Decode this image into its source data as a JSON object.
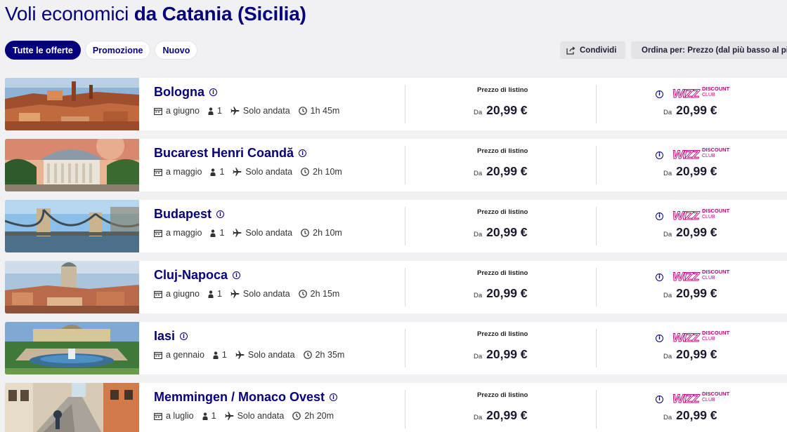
{
  "page": {
    "title_prefix": "Voli economici ",
    "title_bold": "da Catania (Sicilia)"
  },
  "filters": [
    {
      "label": "Tutte le offerte",
      "active": true
    },
    {
      "label": "Promozione",
      "active": false
    },
    {
      "label": "Nuovo",
      "active": false
    }
  ],
  "toolbar": {
    "share_label": "Condividi",
    "sort_label": "Ordina per: Prezzo (dal più basso al più"
  },
  "labels": {
    "list_price": "Prezzo di listino",
    "from": "Da",
    "club_brand": "WIZZ",
    "club_line1": "DISCOUNT",
    "club_line2": "CLUB"
  },
  "colors": {
    "brand_navy": "#06007a",
    "wizz_pink": "#c6007e"
  },
  "offers": [
    {
      "destination": "Bologna",
      "month": "a giugno",
      "passengers": "1",
      "trip": "Solo andata",
      "duration": "1h 45m",
      "price": "20,99 €",
      "club_price": "20,99 €",
      "image": "bologna-rooftops"
    },
    {
      "destination": "Bucarest Henri Coandă",
      "month": "a maggio",
      "passengers": "1",
      "trip": "Solo andata",
      "duration": "2h 10m",
      "price": "20,99 €",
      "club_price": "20,99 €",
      "image": "bucharest-athenaeum"
    },
    {
      "destination": "Budapest",
      "month": "a maggio",
      "passengers": "1",
      "trip": "Solo andata",
      "duration": "2h 10m",
      "price": "20,99 €",
      "club_price": "20,99 €",
      "image": "budapest-chain-bridge"
    },
    {
      "destination": "Cluj-Napoca",
      "month": "a giugno",
      "passengers": "1",
      "trip": "Solo andata",
      "duration": "2h 15m",
      "price": "20,99 €",
      "club_price": "20,99 €",
      "image": "cluj-cathedral"
    },
    {
      "destination": "Iasi",
      "month": "a gennaio",
      "passengers": "1",
      "trip": "Solo andata",
      "duration": "2h 35m",
      "price": "20,99 €",
      "club_price": "20,99 €",
      "image": "iasi-palace-fountain"
    },
    {
      "destination": "Memmingen / Monaco Ovest",
      "month": "a luglio",
      "passengers": "1",
      "trip": "Solo andata",
      "duration": "2h 20m",
      "price": "20,99 €",
      "club_price": "20,99 €",
      "image": "memmingen-street"
    }
  ]
}
